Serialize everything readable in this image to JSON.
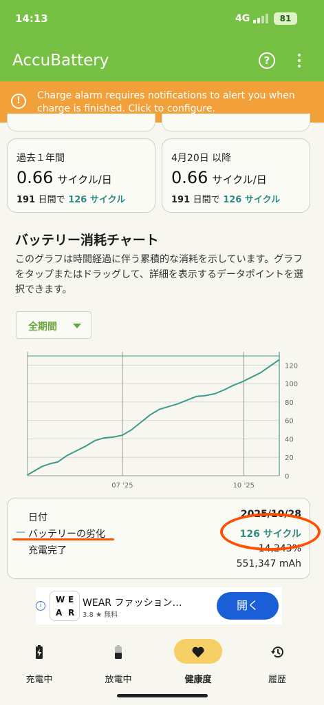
{
  "status_bar": {
    "time": "14:13",
    "network": "4G",
    "battery": "81"
  },
  "app": {
    "title": "AccuBattery",
    "help_icon": "help-circle-icon",
    "menu_icon": "more-vert-icon"
  },
  "alert": {
    "icon": "alert-circle-icon",
    "text": "Charge alarm requires notifications to alert you when charge is finished. Click to configure."
  },
  "cards": [
    {
      "heading": "過去１年間",
      "value": "0.66",
      "unit": "サイクル/日",
      "days": "191",
      "days_label": "日間で",
      "cycles": "126 サイクル"
    },
    {
      "heading": "4月20日 以降",
      "value": "0.66",
      "unit": "サイクル/日",
      "days": "191",
      "days_label": "日間で",
      "cycles": "126 サイクル"
    }
  ],
  "section": {
    "title": "バッテリー消耗チャート",
    "description": "このグラフは時間経過に伴う累積的な消耗を示しています。グラフをタップまたはドラッグして、詳細を表示するデータポイントを選択できます。"
  },
  "filter": {
    "label": "全期間"
  },
  "chart_data": {
    "type": "line",
    "title": "",
    "xlabel": "",
    "ylabel": "",
    "x_ticks": [
      "07 '25",
      "10 '25"
    ],
    "y_ticks": [
      0,
      20,
      40,
      60,
      80,
      100,
      120
    ],
    "ylim": [
      0,
      130
    ],
    "xlim": [
      "2025-04-20",
      "2025-10-28"
    ],
    "grid": true,
    "series_color": "#3c9a8a",
    "series": [
      {
        "name": "バッテリーの劣化",
        "x": [
          "2025-04-20",
          "2025-04-25",
          "2025-05-01",
          "2025-05-07",
          "2025-05-13",
          "2025-05-20",
          "2025-05-27",
          "2025-06-03",
          "2025-06-10",
          "2025-06-17",
          "2025-06-24",
          "2025-07-01",
          "2025-07-08",
          "2025-07-15",
          "2025-07-22",
          "2025-07-29",
          "2025-08-05",
          "2025-08-12",
          "2025-08-19",
          "2025-08-26",
          "2025-09-02",
          "2025-09-09",
          "2025-09-16",
          "2025-09-23",
          "2025-09-30",
          "2025-10-07",
          "2025-10-14",
          "2025-10-21",
          "2025-10-28"
        ],
        "y": [
          1,
          5,
          10,
          13,
          15,
          22,
          27,
          32,
          38,
          41,
          42,
          44,
          50,
          58,
          66,
          72,
          75,
          78,
          82,
          86,
          87,
          89,
          93,
          98,
          102,
          107,
          112,
          119,
          126
        ]
      }
    ]
  },
  "details": {
    "date_label": "日付",
    "date_value": "2025/10/28",
    "series_label": "バッテリーの劣化",
    "series_value": "126 サイクル",
    "charge_label": "充電完了",
    "charge_value": "14,243%",
    "capacity_value": "551,347 mAh"
  },
  "ad": {
    "info_icon": "info-icon",
    "logo_letters": [
      "W",
      "E",
      "A",
      "R"
    ],
    "app_name": "WEAR ファッション…",
    "rating": "3.8 ★ 無料",
    "button": "開く"
  },
  "bottom_nav": [
    {
      "label": "充電中",
      "icon": "battery-charging-icon",
      "active": false
    },
    {
      "label": "放電中",
      "icon": "battery-discharging-icon",
      "active": false
    },
    {
      "label": "健康度",
      "icon": "heart-icon",
      "active": true
    },
    {
      "label": "履歴",
      "icon": "history-icon",
      "active": false
    }
  ],
  "colors": {
    "brand_green": "#76c043",
    "alert_orange": "#f2a13a",
    "teal": "#2f8a86",
    "highlight_yellow": "#f6cf66",
    "annotation_orange": "#ff4e00",
    "ad_button_blue": "#1a5ed8"
  }
}
